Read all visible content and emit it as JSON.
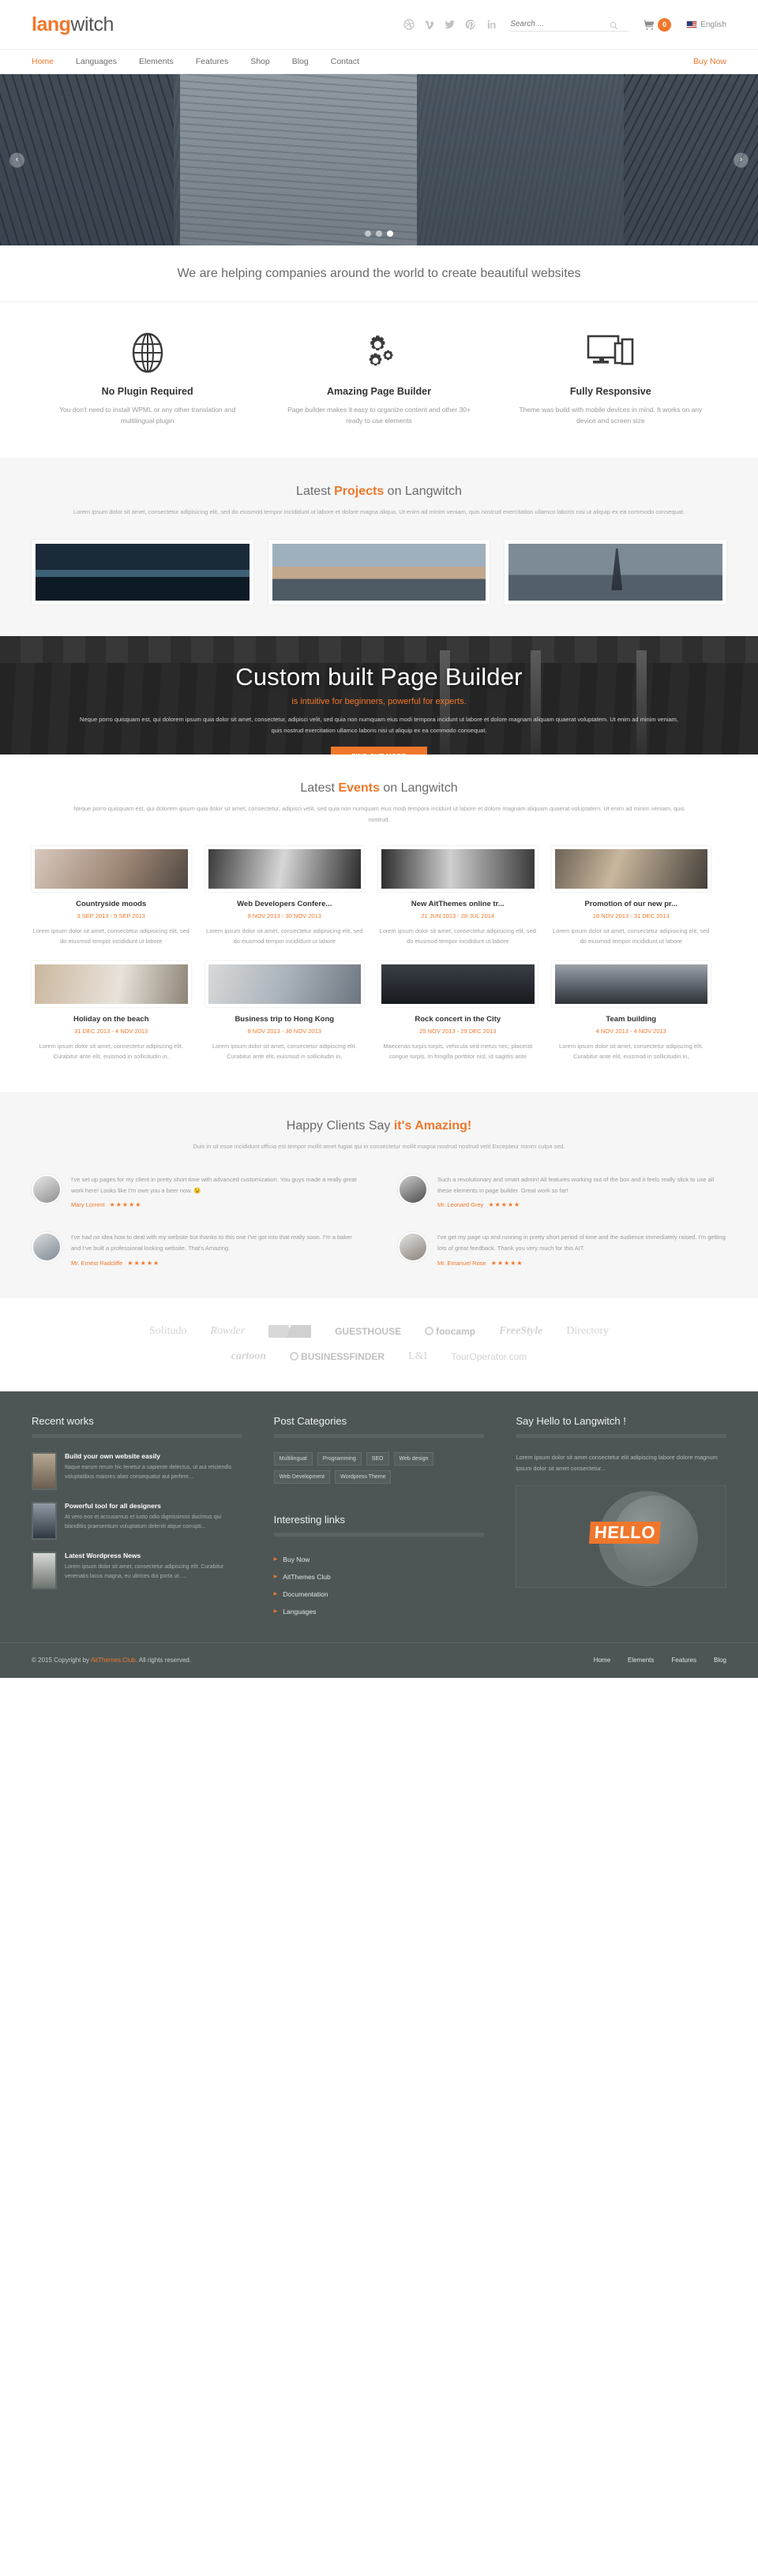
{
  "brand": {
    "part1": "lang",
    "part2": "witch"
  },
  "header": {
    "social": [
      {
        "name": "dribbble-icon",
        "label": "Dribbble"
      },
      {
        "name": "vimeo-icon",
        "label": "Vimeo"
      },
      {
        "name": "twitter-icon",
        "label": "Twitter"
      },
      {
        "name": "pinterest-icon",
        "label": "Pinterest"
      },
      {
        "name": "linkedin-icon",
        "label": "LinkedIn"
      }
    ],
    "search_placeholder": "Search ...",
    "search_value": "",
    "cart_count": "0",
    "language": "English"
  },
  "nav": {
    "items": [
      {
        "label": "Home",
        "active": true
      },
      {
        "label": "Languages",
        "active": false
      },
      {
        "label": "Elements",
        "active": false
      },
      {
        "label": "Features",
        "active": false
      },
      {
        "label": "Shop",
        "active": false
      },
      {
        "label": "Blog",
        "active": false
      },
      {
        "label": "Contact",
        "active": false
      }
    ],
    "buy_now": "Buy Now"
  },
  "hero": {
    "prev_arrow": "‹",
    "next_arrow": "›",
    "slide_count": 3,
    "active_slide": 3
  },
  "tagline": "We are helping companies around the world to create beautiful websites",
  "features": [
    {
      "icon": "globe-icon",
      "title": "No Plugin Required",
      "text": "You don't need to install WPML or any other translation and multilingual plugin"
    },
    {
      "icon": "gears-icon",
      "title": "Amazing Page Builder",
      "text": "Page builder makes it easy to organize content and other 30+ ready to use elements"
    },
    {
      "icon": "devices-icon",
      "title": "Fully Responsive",
      "text": "Theme was build with mobile devices in mind. It works on any device and screen size"
    }
  ],
  "projects": {
    "title_pre": "Latest ",
    "title_hi": "Projects",
    "title_post": " on Langwitch",
    "desc": "Lorem ipsum dolor sit amet, consectetur adipisicing elit, sed do eiusmod tempor incididunt ut labore et dolore magna aliqua. Ut enim ad minim veniam, quis nostrud exercitation ullamco laboris nisi ut aliquip ex ea commodo consequat.",
    "items": [
      {
        "name": "project-venice-night"
      },
      {
        "name": "project-venice-canal"
      },
      {
        "name": "project-eiffel-tower"
      }
    ]
  },
  "pagebuilder": {
    "heading": "Custom built Page Builder",
    "subheading": "is intuitive for beginners, powerful for experts.",
    "desc": "Neque porro quisquam est, qui dolorem ipsum quia dolor sit amet, consectetur, adipisci velit, sed quia non numquam eius modi tempora incidunt ut labore et dolore magnam aliquam quaerat voluptatem. Ut enim ad minim veniam, quis nostrud exercitation ullamco laboris nisi ut aliquip ex ea commodo consequat.",
    "button": "FIND OUT MORE"
  },
  "events": {
    "title_pre": "Latest ",
    "title_hi": "Events",
    "title_post": " on Langwitch",
    "desc": "Neque porro quisquam est, qui dolorem ipsum quia dolor sit amet, consectetur, adipisci velit, sed quia non numquam eius modi tempora incidunt ut labore et dolore magnam aliquam quaerat voluptatem. Ut enim ad minim veniam, quis nostrud.",
    "items": [
      {
        "title": "Countryside moods",
        "date": "3 SEP 2013 - 9 SEP 2013",
        "text": "Lorem ipsum dolor sit amet, consectetur adipisicing elit, sed do eiusmod tempor incididunt ut labore"
      },
      {
        "title": "Web Developers Confere...",
        "date": "9 NOV 2013 - 30 NOV 2013",
        "text": "Lorem ipsum dolor sit amet, consectetur adipisicing elit, sed do eiusmod tempor incididunt ut labore"
      },
      {
        "title": "New AitThemes online tr...",
        "date": "21 JUN 2013 - 28 JUL 2014",
        "text": "Lorem ipsum dolor sit amet, consectetur adipisicing elit, sed do eiusmod tempor incididunt ut labore"
      },
      {
        "title": "Promotion of our new pr...",
        "date": "18 NOV 2013 - 31 DEC 2013",
        "text": "Lorem ipsum dolor sit amet, consectetur adipisicing elit, sed do eiusmod tempor incididunt ut labore"
      },
      {
        "title": "Holiday on the beach",
        "date": "31 DEC 2013 - 4 NOV 2013",
        "text": "Lorem ipsum dolor sit amet, consectetur adipiscing elit. Curabitur ante elit, euismod in sollicitudin in,"
      },
      {
        "title": "Business trip to Hong Kong",
        "date": "8 NOV 2013 - 30 NOV 2013",
        "text": "Lorem ipsum dolor sit amet, consectetur adipiscing elit. Curabitur ante elit, euismod in sollicitudin in,"
      },
      {
        "title": "Rock concert in the City",
        "date": "25 NOV 2013 - 29 DEC 2013",
        "text": "Maecenas turpis turpis, vehicula sed metus nec, placerat congue turpis. In fringilla porttitor nisl, id sagittis ante"
      },
      {
        "title": "Team building",
        "date": "4 NOV 2013 - 4 NOV 2013",
        "text": "Lorem ipsum dolor sit amet, consectetur adipiscing elit. Curabitur ante elit, euismod in sollicitudin in,"
      }
    ]
  },
  "testimonials": {
    "title_pre": "Happy Clients Say ",
    "title_hi": "it's Amazing!",
    "desc": "Duis in sit esse incididunt officia est tempor mollit amet fugiat qui in consectetur mollit magna nostrud nostrud velit Excepteur minim culpa sed.",
    "items": [
      {
        "quote": "I've set up pages for my client in pretty short time with advanced customization. You guys made a really great work here! Looks like I'm owe you a beer now. 😉",
        "author": "Mary Lorrent",
        "stars": "★★★★★"
      },
      {
        "quote": "Such a revolutionary and smart admin! All features working out of the box and it feels really slick to use all these elements in page builder. Great work so far!",
        "author": "Mr. Leonard Grey",
        "stars": "★★★★★"
      },
      {
        "quote": "I've had no idea how to deal with my website but thanks to this one I've got into that really soon. I'm a baker and I've built a professional looking website. That's Amazing.",
        "author": "Mr. Ernest Radcliffe",
        "stars": "★★★★★"
      },
      {
        "quote": "I've get my page up and running in pretty short period of time and the audience immediately raised. I'm getting lots of great feedback. Thank you very much for this AIT.",
        "author": "Mr. Emanuel Rose",
        "stars": "★★★★★"
      }
    ]
  },
  "clients": {
    "row1": [
      "Solitudo",
      "Rowder",
      "mountain-logo",
      "GUESTHOUSE",
      "foocamp",
      "FreeStyle",
      "Directory"
    ],
    "row2": [
      "cartoon",
      "BUSINESSFINDER",
      "L&I",
      "TourOperator.com"
    ]
  },
  "footer": {
    "recent_works": {
      "title": "Recent works",
      "items": [
        {
          "title": "Build your own website easily",
          "text": "Itaque earum rerum hic tenetur a sapiente delectus, ut aut reiciendis voluptatibus maiores alias consequatur aut perfere..."
        },
        {
          "title": "Powerful tool for all designers",
          "text": "At vero eos et accusamus et iusto odio dignissimos ducimus qui blanditiis praesentium voluptatum deleniti atque corrupti..."
        },
        {
          "title": "Latest Wordpress News",
          "text": "Lorem ipsum dolor sit amet, consectetur adipiscing elit. Curabitur venenatis lacus magna, eu ultrices dui porta ut. ..."
        }
      ]
    },
    "post_categories": {
      "title": "Post Categories",
      "tags": [
        "Multilingual",
        "Programming",
        "SEO",
        "Web design",
        "Web Development",
        "Wordpress Theme"
      ]
    },
    "interesting_links": {
      "title": "Interesting links",
      "links": [
        "Buy Now",
        "AitThemes Club",
        "Documentation",
        "Languages"
      ]
    },
    "say_hello": {
      "title": "Say Hello to Langwitch !",
      "text": "Lorem ipsum dolor sit amet consectetur elit adipiscing labore dolore magnum ipsum dolor sit amet consectetur...",
      "image_word": "HELLO"
    },
    "copyright_pre": "© 2015 Copyright by ",
    "copyright_link": "AitThemes.Club",
    "copyright_post": ". All rights reserved.",
    "bottom_nav": [
      "Home",
      "Elements",
      "Features",
      "Blog"
    ]
  },
  "colors": {
    "accent": "#f0772b",
    "footer_bg": "#4d5655",
    "text": "#555555"
  }
}
